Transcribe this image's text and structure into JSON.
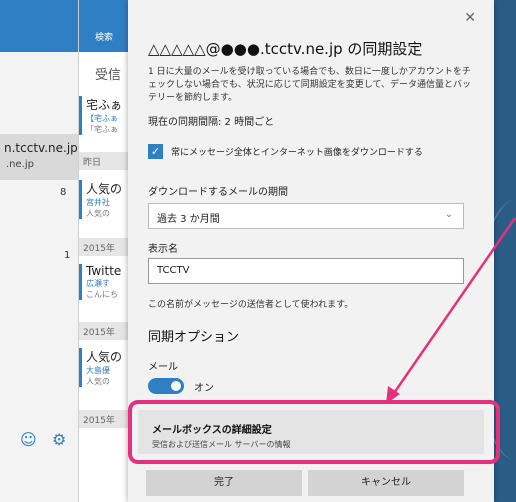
{
  "background": {
    "search_label": "検索",
    "inbox_label": "受信",
    "account_name": "n.tcctv.ne.jp",
    "account_domain": ".ne.jp",
    "count_8": "8",
    "count_1": "1",
    "date_yesterday": "昨日",
    "mail_items": [
      {
        "sender": "宅ふぁ",
        "sub": "【宅ふぁ",
        "sub2": "「宅ふぁ"
      },
      {
        "sender": "人気の",
        "sub": "宮井社",
        "sub2": "人気の"
      },
      {
        "sender": "Twitte",
        "sub": "広瀬す",
        "sub2": "こんにち"
      },
      {
        "sender": "人気の",
        "sub": "大島優",
        "sub2": "人気の"
      }
    ],
    "date_2015_a": "2015年",
    "date_2015_b": "2015年",
    "date_2015_c": "2015年"
  },
  "dialog": {
    "close_icon": "close-icon",
    "title": "△△△△△@●●●.tcctv.ne.jp の同期設定",
    "description": "1 日に大量のメールを受け取っている場合でも、数日に一度しかアカウントをチェックしない場合でも、状況に応じて同期設定を変更して、データ通信量とバッテリーを節約します。",
    "current_interval": "現在の同期間隔: 2 時間ごと",
    "checkbox_label": "常にメッセージ全体とインターネット画像をダウンロードする",
    "download_period_label": "ダウンロードするメールの期間",
    "download_period_value": "過去 3 か月間",
    "display_name_label": "表示名",
    "display_name_value": "TCCTV",
    "display_name_hint": "この名前がメッセージの送信者として使われます。",
    "sync_options_heading": "同期オプション",
    "mail_label": "メール",
    "toggle_state": "オン",
    "advanced_title": "メールボックスの詳細設定",
    "advanced_subtitle": "受信および送信メール サーバーの情報",
    "done_button": "完了",
    "cancel_button": "キャンセル"
  },
  "colors": {
    "accent": "#2f7fc4",
    "highlight": "#e5307b"
  }
}
